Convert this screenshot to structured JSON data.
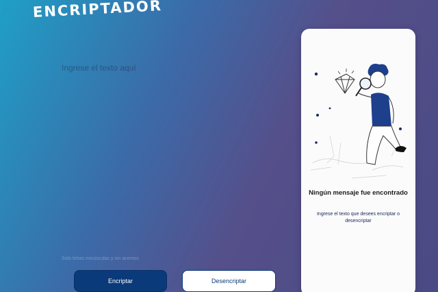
{
  "app": {
    "logo_text": "ENCRIPTADOR"
  },
  "editor": {
    "placeholder": "Ingrese el texto aquí"
  },
  "hint": {
    "icon": "info-icon",
    "text": "Solo letras minúsculas y sin acentos"
  },
  "actions": {
    "encrypt_label": "Encriptar",
    "decrypt_label": "Desencriptar"
  },
  "output_panel": {
    "illustration": "person-with-magnifier-illustration",
    "title": "Ningún mensaje fue encontrado",
    "description": "Ingrese el texto que desees encriptar o desencriptar"
  },
  "colors": {
    "gradient_start": "#1f9fc6",
    "gradient_end": "#4a4a84",
    "button_primary": "#0b3a7a",
    "panel_bg": "#fbfbfb"
  }
}
